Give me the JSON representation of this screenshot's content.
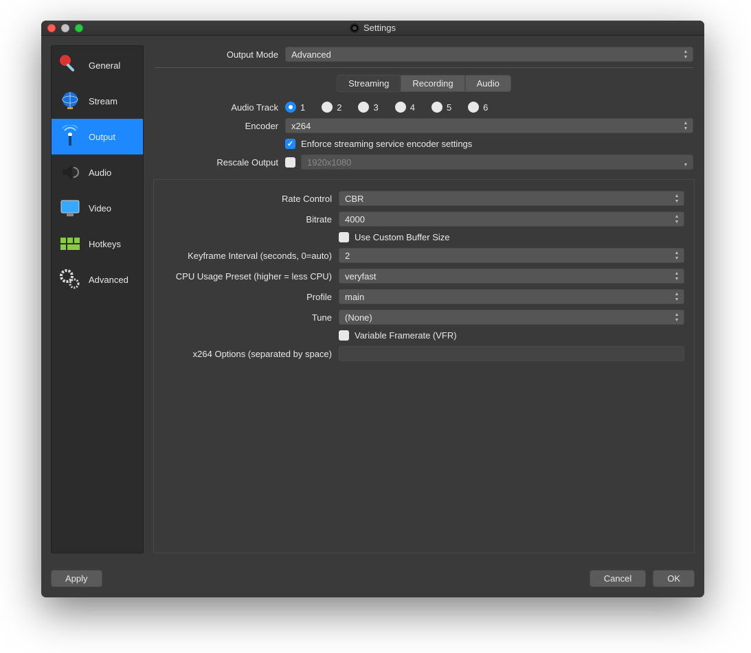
{
  "window": {
    "title": "Settings"
  },
  "sidebar": {
    "items": [
      {
        "label": "General"
      },
      {
        "label": "Stream"
      },
      {
        "label": "Output"
      },
      {
        "label": "Audio"
      },
      {
        "label": "Video"
      },
      {
        "label": "Hotkeys"
      },
      {
        "label": "Advanced"
      }
    ],
    "selected_index": 2
  },
  "output_mode": {
    "label": "Output Mode",
    "value": "Advanced"
  },
  "tabs": {
    "items": [
      "Streaming",
      "Recording",
      "Audio"
    ],
    "active_index": 0
  },
  "audio_track": {
    "label": "Audio Track",
    "options": [
      "1",
      "2",
      "3",
      "4",
      "5",
      "6"
    ],
    "selected": "1"
  },
  "encoder": {
    "label": "Encoder",
    "value": "x264"
  },
  "enforce": {
    "label": "Enforce streaming service encoder settings",
    "checked": true
  },
  "rescale": {
    "label": "Rescale Output",
    "checked": false,
    "placeholder": "1920x1080"
  },
  "rate_control": {
    "label": "Rate Control",
    "value": "CBR"
  },
  "bitrate": {
    "label": "Bitrate",
    "value": "4000"
  },
  "custom_buffer": {
    "label": "Use Custom Buffer Size",
    "checked": false
  },
  "keyframe": {
    "label": "Keyframe Interval (seconds, 0=auto)",
    "value": "2"
  },
  "cpu_preset": {
    "label": "CPU Usage Preset (higher = less CPU)",
    "value": "veryfast"
  },
  "profile": {
    "label": "Profile",
    "value": "main"
  },
  "tune": {
    "label": "Tune",
    "value": "(None)"
  },
  "vfr": {
    "label": "Variable Framerate (VFR)",
    "checked": false
  },
  "x264_opts": {
    "label": "x264 Options (separated by space)",
    "value": ""
  },
  "buttons": {
    "apply": "Apply",
    "cancel": "Cancel",
    "ok": "OK"
  }
}
